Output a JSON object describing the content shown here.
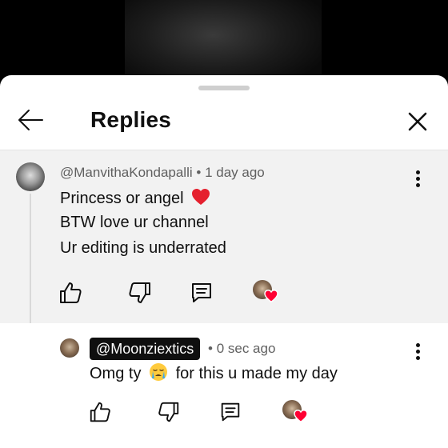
{
  "header": {
    "title": "Replies"
  },
  "parent_comment": {
    "author": "@ManvithaKondapalli",
    "separator": "•",
    "time": "1 day ago",
    "lines": [
      "Princess  or angel",
      "BTW  love ur channel",
      "Ur editing  is underrated"
    ],
    "heart_emoji": "❤️"
  },
  "reply_comment": {
    "author": "@Moonziextics",
    "separator": "•",
    "time": "0 sec ago",
    "text_before_emoji": "Omg ty",
    "emoji": "😭",
    "text_after_emoji": "for this u made my day"
  },
  "icons": {
    "back": "arrow-left-icon",
    "close": "close-icon",
    "more": "more-vert-icon",
    "like": "thumbs-up-icon",
    "dislike": "thumbs-down-icon",
    "reply": "comment-icon",
    "creator_heart": "creator-heart-icon"
  },
  "colors": {
    "heart": "#ff0033",
    "parent_bg": "#f2f2f2",
    "text": "#0f0f0f",
    "meta": "#606060"
  }
}
